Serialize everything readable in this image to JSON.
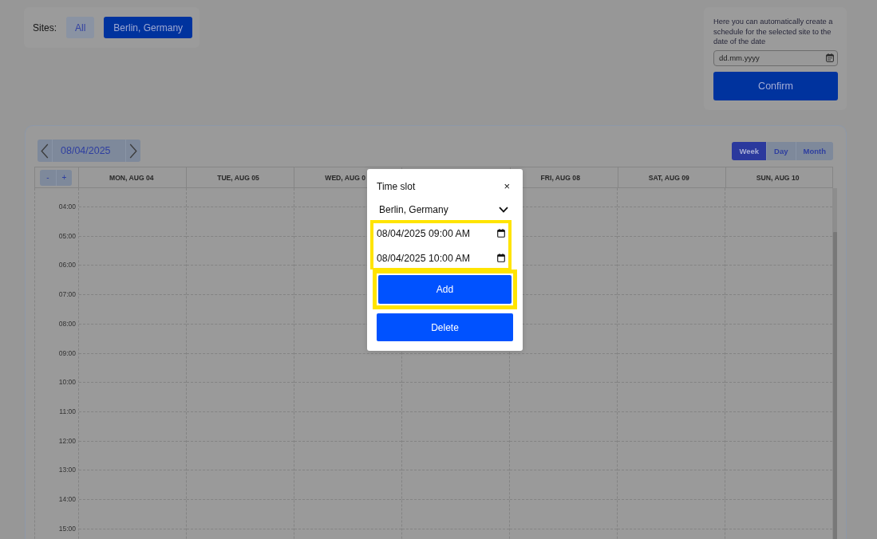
{
  "sites": {
    "label": "Sites:",
    "options": [
      {
        "label": "All",
        "selected": false
      },
      {
        "label": "Berlin, Germany",
        "selected": true
      }
    ]
  },
  "auto_schedule": {
    "description": "Here you can automatically create a schedule for the selected site to the date of the date",
    "date_field": {
      "placeholder": "dd.mm.yyyy"
    },
    "confirm_button": "Confirm"
  },
  "calendar": {
    "date": "08/04/2025",
    "views": [
      {
        "label": "Week",
        "selected": true
      },
      {
        "label": "Day",
        "selected": false
      },
      {
        "label": "Month",
        "selected": false
      }
    ],
    "zoom_buttons": [
      "-",
      "+"
    ],
    "day_headers": {
      "left": [
        "MON, AUG 04",
        "TUE, AUG 05",
        "WED, AUG 0"
      ],
      "right": [
        "FRI, AUG 08",
        "SAT, AUG 09",
        "SUN, AUG 10"
      ]
    },
    "times": [
      "04:00",
      "05:00",
      "06:00",
      "07:00",
      "08:00",
      "09:00",
      "10:00",
      "11:00",
      "12:00",
      "13:00",
      "14:00",
      "15:00"
    ]
  },
  "dialog": {
    "title": "Time slot",
    "close": "×",
    "site_select": {
      "value": "Berlin, Germany"
    },
    "time_fields": {
      "highlighted": true,
      "values": [
        "08/04/2025 09:00 AM",
        "08/04/2025 10:00 AM"
      ]
    },
    "buttons": [
      {
        "label": "Add",
        "highlighted": true
      },
      {
        "label": "Delete",
        "highlighted": false
      }
    ]
  }
}
